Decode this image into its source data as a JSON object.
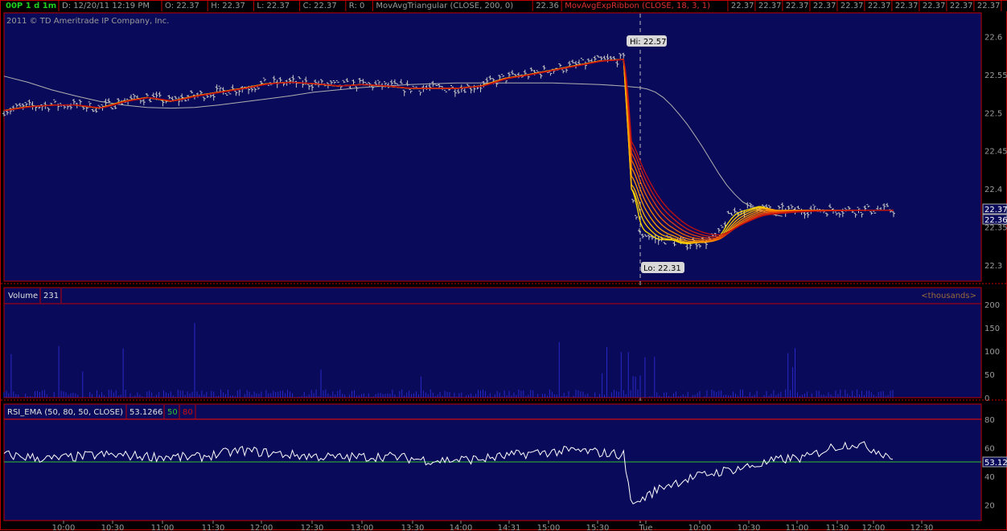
{
  "header": {
    "symbol_label": "00P 1 d 1m",
    "fields": [
      "D: 12/20/11 12:19 PM",
      "O: 22.37",
      "H: 22.37",
      "L: 22.37",
      "C: 22.37",
      "R: 0"
    ],
    "study_tri": "MovAvgTriangular (CLOSE, 200, 0)",
    "study_tri_value": "22.36",
    "study_ribbon": "MovAvgExpRibbon (CLOSE, 18, 3, 1)",
    "ribbon_values": [
      "22.37",
      "22.37",
      "22.37",
      "22.37",
      "22.37",
      "22.37",
      "22.37",
      "22.37",
      "22.37",
      "22.37",
      "22.37"
    ],
    "copyright": "2011 © TD Ameritrade IP Company, Inc."
  },
  "colors": {
    "panel_bg": "#0a0a5a",
    "border": "#c00000",
    "price_bars": "#cccccc",
    "ribbon_light": "#ffe000",
    "ribbon_dark": "#d01010",
    "triangular_ma": "#b0b0b0",
    "volume": "#3030d0",
    "rsi_line": "#ffffff",
    "rsi_mid": "#30c030",
    "rsi_over": "#d01010",
    "badge_bg": "#d8d8d8"
  },
  "price_panel": {
    "hi_label": "Hi: 22.57",
    "lo_label": "Lo: 22.31",
    "current_labels": [
      "22.37",
      "22.36"
    ]
  },
  "volume_panel": {
    "title": "Volume",
    "value": "231",
    "units": "<thousands>"
  },
  "rsi_panel": {
    "title": "RSI_EMA (50, 80, 50, CLOSE)",
    "value": "53.1266",
    "level_mid": "50",
    "level_high": "80",
    "current_label": "53.12"
  },
  "chart_data": [
    {
      "type": "line",
      "name": "price",
      "ylim": [
        22.28,
        22.63
      ],
      "y_ticks": [
        "22.6",
        "22.55",
        "22.5",
        "22.45",
        "22.4",
        "22.35",
        "22.3"
      ],
      "x": [
        0,
        30,
        60,
        90,
        120,
        150,
        180,
        210,
        240,
        270,
        300,
        330,
        360,
        390,
        420,
        450,
        480,
        510,
        540,
        570,
        600,
        630,
        660,
        690,
        720,
        750,
        780,
        790,
        800,
        810,
        820,
        830,
        840,
        850,
        860,
        870,
        880,
        890,
        900,
        910,
        920,
        930,
        940,
        950,
        960,
        970,
        980
      ],
      "close": [
        22.503,
        22.508,
        22.51,
        22.51,
        22.506,
        22.515,
        22.52,
        22.515,
        22.522,
        22.527,
        22.532,
        22.538,
        22.54,
        22.538,
        22.535,
        22.537,
        22.535,
        22.532,
        22.532,
        22.532,
        22.535,
        22.545,
        22.55,
        22.556,
        22.562,
        22.568,
        22.57,
        22.4,
        22.34,
        22.34,
        22.333,
        22.333,
        22.333,
        22.328,
        22.328,
        22.33,
        22.33,
        22.333,
        22.34,
        22.36,
        22.37,
        22.372,
        22.375,
        22.378,
        22.373,
        22.37,
        22.372
      ],
      "triangular_ma": [
        22.548,
        22.54,
        22.53,
        22.522,
        22.515,
        22.51,
        22.507,
        22.506,
        22.507,
        22.51,
        22.514,
        22.518,
        22.522,
        22.527,
        22.53,
        22.533,
        22.535,
        22.537,
        22.538,
        22.539,
        22.539,
        22.539,
        22.539,
        22.539,
        22.538,
        22.537,
        22.535,
        22.534,
        22.533,
        22.531,
        22.527,
        22.52,
        22.51,
        22.498,
        22.485,
        22.47,
        22.454,
        22.437,
        22.42,
        22.405,
        22.393,
        22.383,
        22.377,
        22.373,
        22.369,
        22.366,
        22.364
      ],
      "annotations": [
        "Hi: 22.57",
        "Lo: 22.31"
      ]
    },
    {
      "type": "bar",
      "name": "volume",
      "ylim": [
        0,
        200
      ],
      "y_ticks": [
        "200",
        "150",
        "100",
        "50",
        "0"
      ],
      "units": "<thousands>"
    },
    {
      "type": "line",
      "name": "rsi",
      "ylim": [
        10,
        90
      ],
      "y_ticks": [
        "80",
        "60",
        "40",
        "20"
      ],
      "levels": [
        50,
        80
      ],
      "x": [
        0,
        60,
        120,
        180,
        240,
        300,
        360,
        420,
        480,
        540,
        600,
        660,
        720,
        780,
        790,
        800,
        830,
        860,
        890,
        920,
        950,
        980,
        1010,
        1040,
        1070,
        1100,
        1120
      ],
      "values": [
        55,
        52,
        55,
        54,
        53,
        58,
        55,
        53,
        54,
        51,
        52,
        56,
        58,
        55,
        20,
        23,
        33,
        38,
        42,
        45,
        48,
        52,
        53,
        60,
        63,
        58,
        53
      ]
    }
  ],
  "time_axis": [
    "10:00",
    "10:30",
    "11:00",
    "11:30",
    "12:00",
    "12:30",
    "13:00",
    "13:30",
    "14:00",
    "14:31",
    "15:00",
    "15:30",
    "Tue",
    "10:00",
    "10:30",
    "11:00",
    "11:30",
    "12:00",
    "12:30"
  ]
}
